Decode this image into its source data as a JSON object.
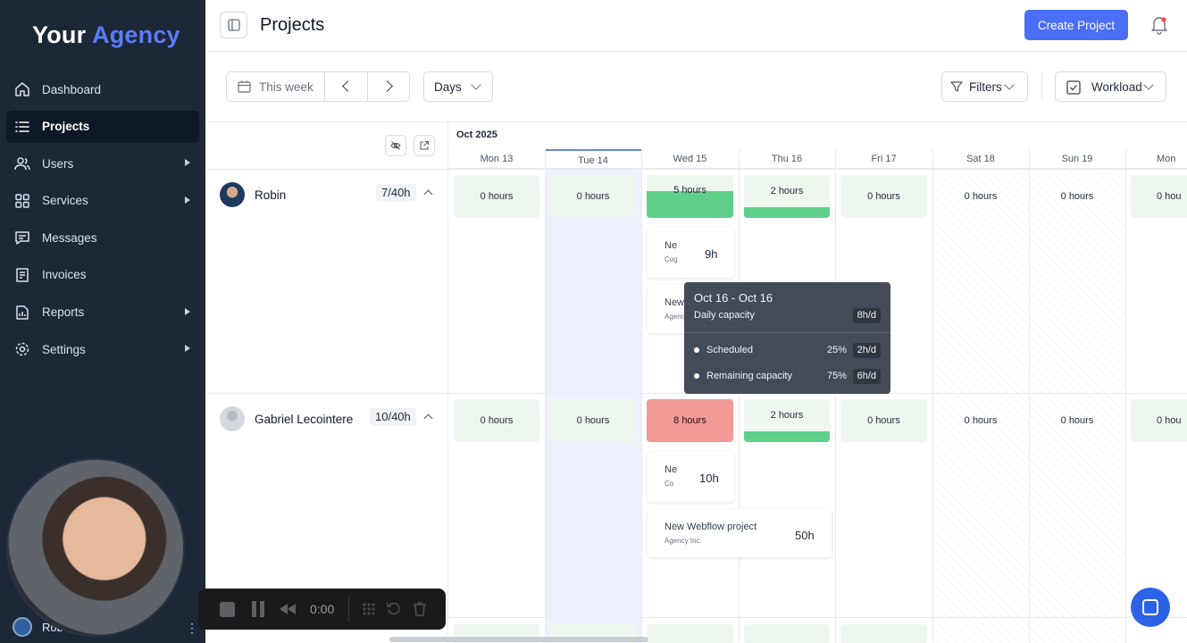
{
  "logo": {
    "word1": "Your",
    "word2": "Agency"
  },
  "nav": [
    {
      "label": "Dashboard",
      "icon": "home-icon",
      "active": false,
      "arrow": false
    },
    {
      "label": "Projects",
      "icon": "list-icon",
      "active": true,
      "arrow": false
    },
    {
      "label": "Users",
      "icon": "users-icon",
      "active": false,
      "arrow": true
    },
    {
      "label": "Services",
      "icon": "grid-icon",
      "active": false,
      "arrow": true
    },
    {
      "label": "Messages",
      "icon": "message-icon",
      "active": false,
      "arrow": false
    },
    {
      "label": "Invoices",
      "icon": "invoice-icon",
      "active": false,
      "arrow": false
    },
    {
      "label": "Reports",
      "icon": "report-icon",
      "active": false,
      "arrow": true
    },
    {
      "label": "Settings",
      "icon": "gear-icon",
      "active": false,
      "arrow": true
    }
  ],
  "user": {
    "name": "Rob"
  },
  "header": {
    "title": "Projects",
    "create_label": "Create Project"
  },
  "toolbar": {
    "week_label": "This week",
    "view_label": "Days",
    "filters_label": "Filters",
    "mode_label": "Workload"
  },
  "calendar": {
    "month": "Oct 2025",
    "days": [
      "Mon 13",
      "Tue 14",
      "Wed 15",
      "Thu 16",
      "Fri 17",
      "Sat 18",
      "Sun 19",
      "Mon"
    ]
  },
  "people": [
    {
      "name": "Robin",
      "capacity": "7/40h",
      "cells": [
        "0 hours",
        "0 hours",
        "5 hours",
        "2 hours",
        "0 hours",
        "0 hours",
        "0 hours",
        "0 hou"
      ],
      "tasks": [
        {
          "name": "Ne",
          "client": "Cog",
          "hours": "9h"
        },
        {
          "name": "New",
          "client": "Agenc",
          "hours": ""
        }
      ]
    },
    {
      "name": "Gabriel Lecointere",
      "capacity": "10/40h",
      "cells": [
        "0 hours",
        "0 hours",
        "8 hours",
        "2 hours",
        "0 hours",
        "0 hours",
        "0 hours",
        "0 hou"
      ],
      "tasks": [
        {
          "name": "Ne",
          "client": "Co",
          "hours": "10h"
        },
        {
          "name": "New Webflow project",
          "client": "Agency Inc.",
          "hours": "50h"
        }
      ]
    }
  ],
  "tooltip": {
    "range": "Oct 16 - Oct 16",
    "capacity_label": "Daily capacity",
    "capacity_value": "8h/d",
    "scheduled_label": "Scheduled",
    "scheduled_pct": "25%",
    "scheduled_value": "2h/d",
    "remaining_label": "Remaining capacity",
    "remaining_pct": "75%",
    "remaining_value": "6h/d"
  },
  "recorder": {
    "time": "0:00"
  },
  "colors": {
    "accent": "#4a6ef5",
    "sidebar": "#1c2738",
    "green_fill": "#5fcf8a",
    "over_capacity": "#f19a96"
  }
}
